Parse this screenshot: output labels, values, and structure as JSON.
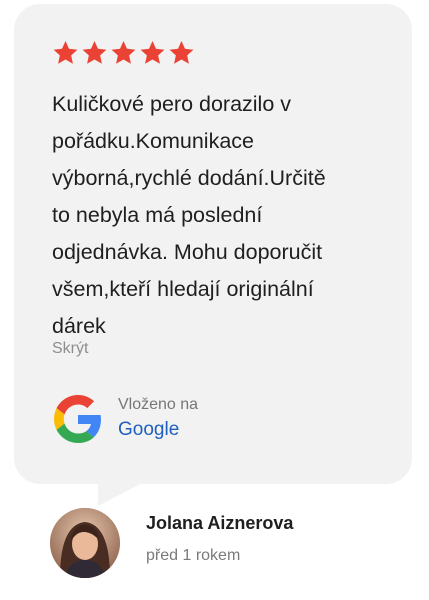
{
  "review": {
    "rating": 5,
    "rating_max": 5,
    "star_color": "#ea4335",
    "text_lines": [
      "Kuličkové pero dorazilo v",
      "pořádku.Komunikace",
      "výborná,rychlé dodání.Určitě",
      "to nebyla má poslední",
      "odjednávka. Mohu doporučit",
      "všem,kteří hledají originální",
      "dárek"
    ],
    "hide_label": "Skrýt",
    "posted_on_label": "Vloženo na",
    "platform_label": "Google"
  },
  "author": {
    "name": "Jolana Aiznerova",
    "time_ago": "před 1 rokem"
  }
}
